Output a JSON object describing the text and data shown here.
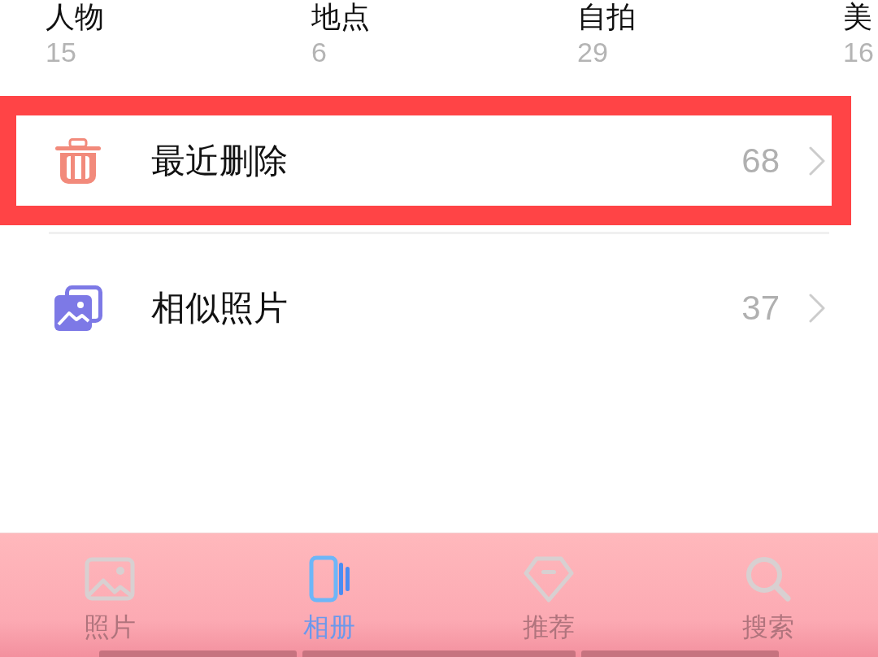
{
  "categories": [
    {
      "label": "人物",
      "count": "15"
    },
    {
      "label": "地点",
      "count": "6"
    },
    {
      "label": "自拍",
      "count": "29"
    },
    {
      "label": "美",
      "count": "16"
    }
  ],
  "albums": [
    {
      "label": "最近删除",
      "count": "68",
      "highlighted": true
    },
    {
      "label": "相似照片",
      "count": "37",
      "highlighted": false
    }
  ],
  "tab_bar": {
    "tabs": [
      {
        "label": "照片",
        "selected": false
      },
      {
        "label": "相册",
        "selected": true
      },
      {
        "label": "推荐",
        "selected": false
      },
      {
        "label": "搜索",
        "selected": false
      }
    ]
  }
}
